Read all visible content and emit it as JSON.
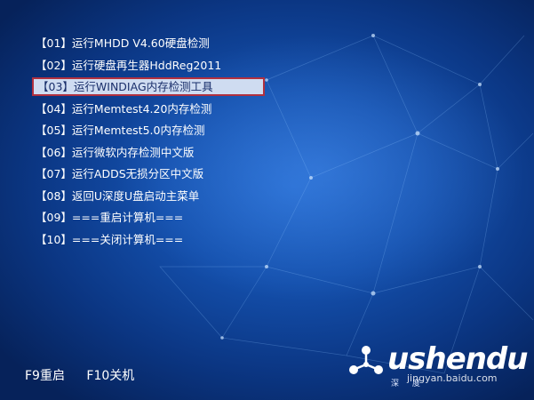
{
  "menu": {
    "items": [
      {
        "label": "【01】运行MHDD V4.60硬盘检测",
        "selected": false
      },
      {
        "label": "【02】运行硬盘再生器HddReg2011",
        "selected": false
      },
      {
        "label": "【03】运行WINDIAG内存检测工具",
        "selected": true
      },
      {
        "label": "【04】运行Memtest4.20内存检测",
        "selected": false
      },
      {
        "label": "【05】运行Memtest5.0内存检测",
        "selected": false
      },
      {
        "label": "【06】运行微软内存检测中文版",
        "selected": false
      },
      {
        "label": "【07】运行ADDS无损分区中文版",
        "selected": false
      },
      {
        "label": "【08】返回U深度U盘启动主菜单",
        "selected": false
      },
      {
        "label": "【09】===重启计算机===",
        "selected": false
      },
      {
        "label": "【10】===关闭计算机===",
        "selected": false
      }
    ]
  },
  "footer": {
    "reboot_key": "F9重启",
    "shutdown_key": "F10关机"
  },
  "logo": {
    "text": "ushendu",
    "sub": "深 度",
    "icon": "ushendu-logo-mark"
  },
  "watermark": {
    "text": "jingyan.baidu.com"
  },
  "colors": {
    "background": "#1450ad",
    "selected_bg": "#cfdcf1",
    "selected_border": "#b0303f",
    "text": "#ffffff"
  }
}
